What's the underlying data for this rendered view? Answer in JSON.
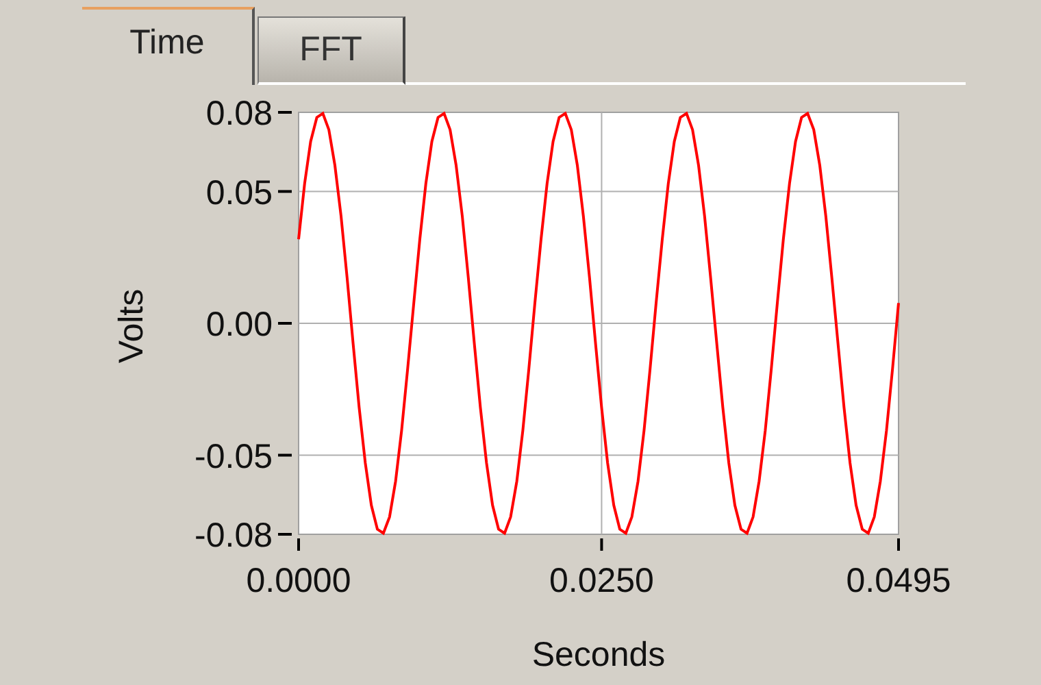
{
  "tabs": [
    {
      "label": "Time",
      "selected": true
    },
    {
      "label": "FFT",
      "selected": false
    }
  ],
  "chart_data": {
    "type": "line",
    "xlabel": "Seconds",
    "ylabel": "Volts",
    "x": [
      0,
      0.0005,
      0.001,
      0.0015,
      0.002,
      0.0025,
      0.003,
      0.0035,
      0.004,
      0.0045,
      0.005,
      0.0055,
      0.006,
      0.0065,
      0.007,
      0.0075,
      0.008,
      0.0085,
      0.009,
      0.0095,
      0.01,
      0.0105,
      0.011,
      0.0115,
      0.012,
      0.0125,
      0.013,
      0.0135,
      0.014,
      0.0145,
      0.015,
      0.0155,
      0.016,
      0.0165,
      0.017,
      0.0175,
      0.018,
      0.0185,
      0.019,
      0.0195,
      0.02,
      0.0205,
      0.021,
      0.0215,
      0.022,
      0.0225,
      0.023,
      0.0235,
      0.024,
      0.0245,
      0.025,
      0.0255,
      0.026,
      0.0265,
      0.027,
      0.0275,
      0.028,
      0.0285,
      0.029,
      0.0295,
      0.03,
      0.0305,
      0.031,
      0.0315,
      0.032,
      0.0325,
      0.033,
      0.0335,
      0.034,
      0.0345,
      0.035,
      0.0355,
      0.036,
      0.0365,
      0.037,
      0.0375,
      0.038,
      0.0385,
      0.039,
      0.0395,
      0.04,
      0.0405,
      0.041,
      0.0415,
      0.042,
      0.0425,
      0.043,
      0.0435,
      0.044,
      0.0445,
      0.045,
      0.0455,
      0.046,
      0.0465,
      0.047,
      0.0475,
      0.048,
      0.0485,
      0.049,
      0.0495
    ],
    "grid": true,
    "series": [
      {
        "color": "#ff0000",
        "values": [
          0.0319,
          0.053,
          0.069,
          0.0781,
          0.0796,
          0.0734,
          0.0599,
          0.0406,
          0.0173,
          -0.0077,
          -0.0319,
          -0.053,
          -0.069,
          -0.0781,
          -0.0796,
          -0.0734,
          -0.0599,
          -0.0406,
          -0.0173,
          0.0077,
          0.0319,
          0.053,
          0.069,
          0.0781,
          0.0796,
          0.0734,
          0.0599,
          0.0406,
          0.0173,
          -0.0077,
          -0.0319,
          -0.053,
          -0.069,
          -0.0781,
          -0.0796,
          -0.0734,
          -0.0599,
          -0.0406,
          -0.0173,
          0.0077,
          0.0319,
          0.053,
          0.069,
          0.0781,
          0.0796,
          0.0734,
          0.0599,
          0.0406,
          0.0173,
          -0.0077,
          -0.0319,
          -0.053,
          -0.069,
          -0.0781,
          -0.0796,
          -0.0734,
          -0.0599,
          -0.0406,
          -0.0173,
          0.0077,
          0.0319,
          0.053,
          0.069,
          0.0781,
          0.0796,
          0.0734,
          0.0599,
          0.0406,
          0.0173,
          -0.0077,
          -0.0319,
          -0.053,
          -0.069,
          -0.0781,
          -0.0796,
          -0.0734,
          -0.0599,
          -0.0406,
          -0.0173,
          0.0077,
          0.0319,
          0.053,
          0.069,
          0.0781,
          0.0796,
          0.0734,
          0.0599,
          0.0406,
          0.0173,
          -0.0077,
          -0.0319,
          -0.053,
          -0.069,
          -0.0781,
          -0.0796,
          -0.0734,
          -0.0599,
          -0.0406,
          -0.0173,
          0.0077
        ]
      }
    ],
    "xlim": [
      0,
      0.0495
    ],
    "ylim": [
      -0.08,
      0.08
    ],
    "xticks": [
      {
        "value": 0,
        "label": "0.0000"
      },
      {
        "value": 0.025,
        "label": "0.0250"
      },
      {
        "value": 0.0495,
        "label": "0.0495"
      }
    ],
    "yticks": [
      {
        "value": 0.08,
        "label": "0.08"
      },
      {
        "value": 0.05,
        "label": "0.05"
      },
      {
        "value": 0,
        "label": "0.00"
      },
      {
        "value": -0.05,
        "label": "-0.05"
      },
      {
        "value": -0.08,
        "label": "-0.08"
      }
    ]
  }
}
